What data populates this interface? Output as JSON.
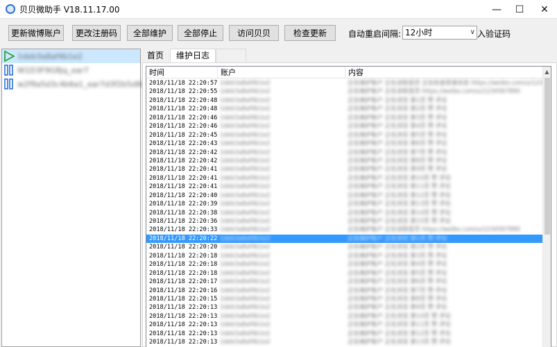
{
  "window": {
    "title": "贝贝微助手 V18.11.17.00",
    "controls": {
      "minimize": "—",
      "maximize": "☐",
      "close": "✕"
    }
  },
  "toolbar": {
    "buttons": [
      {
        "label": "更新微博账户"
      },
      {
        "label": "更改注册码"
      },
      {
        "label": "全部维护"
      },
      {
        "label": "全部停止"
      },
      {
        "label": "访问贝贝"
      },
      {
        "label": "检查更新"
      }
    ],
    "restart_label": "自动重启间隔:",
    "restart_value": "12小时",
    "captcha_label": "入验证码"
  },
  "accounts": [
    {
      "status_icon": "play-icon",
      "name": "1deb3a8af4b1e2"
    },
    {
      "status_icon": "pause-icon",
      "name": "W1D3F9G8jq_ear7"
    },
    {
      "status_icon": "pause-icon",
      "name": "w2f9a5d3c4b6a1_ear7d3f2b5d8c4b3a2e1"
    }
  ],
  "tabs": [
    {
      "label": "首页"
    },
    {
      "label": "维护日志"
    }
  ],
  "log": {
    "columns": [
      "时间",
      "账户",
      "内容"
    ],
    "rows": [
      {
        "time": "2018/11/18 22:20:57",
        "account": "1deb3a8af4b1e2",
        "content": "正在维护账户 正在读取首页 正在检查登录状态 https://weibo.com/u/1234567890"
      },
      {
        "time": "2018/11/18 22:20:55",
        "account": "1deb3a8af4b1e2",
        "content": "正在维护账户 正在读取首页 https://weibo.com/u/1234567890"
      },
      {
        "time": "2018/11/18 22:20:48",
        "account": "1deb3a8af4b1e2",
        "content": "正在维护账户 正在浏览 第1页 赞 评论"
      },
      {
        "time": "2018/11/18 22:20:48",
        "account": "1deb3a8af4b1e2",
        "content": "正在维护账户 正在浏览 第2页 赞 评论"
      },
      {
        "time": "2018/11/18 22:20:46",
        "account": "1deb3a8af4b1e2",
        "content": "正在维护账户 正在浏览 第3页 赞 评论"
      },
      {
        "time": "2018/11/18 22:20:46",
        "account": "1deb3a8af4b1e2",
        "content": "正在维护账户 正在浏览 第4页 赞 评论"
      },
      {
        "time": "2018/11/18 22:20:45",
        "account": "1deb3a8af4b1e2",
        "content": "正在维护账户 正在浏览 第5页 赞 评论"
      },
      {
        "time": "2018/11/18 22:20:43",
        "account": "1deb3a8af4b1e2",
        "content": "正在维护账户 正在浏览 第6页 赞 评论"
      },
      {
        "time": "2018/11/18 22:20:42",
        "account": "1deb3a8af4b1e2",
        "content": "正在维护账户 正在浏览 第7页 赞 评论"
      },
      {
        "time": "2018/11/18 22:20:42",
        "account": "1deb3a8af4b1e2",
        "content": "正在维护账户 正在浏览 第8页 赞 评论"
      },
      {
        "time": "2018/11/18 22:20:41",
        "account": "1deb3a8af4b1e2",
        "content": "正在维护账户 正在浏览 第9页 赞 评论"
      },
      {
        "time": "2018/11/18 22:20:41",
        "account": "1deb3a8af4b1e2",
        "content": "正在维护账户 正在浏览 第10页 赞 评论"
      },
      {
        "time": "2018/11/18 22:20:41",
        "account": "1deb3a8af4b1e2",
        "content": "正在维护账户 正在浏览 第11页 赞 评论"
      },
      {
        "time": "2018/11/18 22:20:40",
        "account": "1deb3a8af4b1e2",
        "content": "正在维护账户 正在浏览 第12页 赞 评论"
      },
      {
        "time": "2018/11/18 22:20:39",
        "account": "1deb3a8af4b1e2",
        "content": "正在维护账户 正在浏览 第13页 赞 评论"
      },
      {
        "time": "2018/11/18 22:20:38",
        "account": "1deb3a8af4b1e2",
        "content": "正在维护账户 正在浏览 第14页 赞 评论"
      },
      {
        "time": "2018/11/18 22:20:36",
        "account": "1deb3a8af4b1e2",
        "content": "正在维护账户 正在浏览 第15页 赞 评论"
      },
      {
        "time": "2018/11/18 22:20:33",
        "account": "1deb3a8af4b1e2",
        "content": "正在维护账户 正在读取首页 https://weibo.com/u/1234567890"
      },
      {
        "time": "2018/11/18 22:20:22",
        "account": "1deb3a8af4b1e2",
        "content": "正在维护账户 正在浏览 第1页 赞 评论",
        "selected": true
      },
      {
        "time": "2018/11/18 22:20:20",
        "account": "1deb3a8af4b1e2",
        "content": "正在维护账户 正在浏览 第2页 赞 评论"
      },
      {
        "time": "2018/11/18 22:20:18",
        "account": "1deb3a8af4b1e2",
        "content": "正在维护账户 正在浏览 第3页 赞 评论"
      },
      {
        "time": "2018/11/18 22:20:18",
        "account": "1deb3a8af4b1e2",
        "content": "正在维护账户 正在浏览 第4页 赞 评论"
      },
      {
        "time": "2018/11/18 22:20:18",
        "account": "1deb3a8af4b1e2",
        "content": "正在维护账户 正在浏览 第5页 赞 评论"
      },
      {
        "time": "2018/11/18 22:20:17",
        "account": "1deb3a8af4b1e2",
        "content": "正在维护账户 正在浏览 第6页 赞 评论"
      },
      {
        "time": "2018/11/18 22:20:16",
        "account": "1deb3a8af4b1e2",
        "content": "正在维护账户 正在浏览 第7页 赞 评论"
      },
      {
        "time": "2018/11/18 22:20:15",
        "account": "1deb3a8af4b1e2",
        "content": "正在维护账户 正在浏览 第8页 赞 评论"
      },
      {
        "time": "2018/11/18 22:20:13",
        "account": "1deb3a8af4b1e2",
        "content": "正在维护账户 正在浏览 第9页 赞 评论"
      },
      {
        "time": "2018/11/18 22:20:13",
        "account": "1deb3a8af4b1e2",
        "content": "正在维护账户 正在浏览 第10页 赞 评论"
      },
      {
        "time": "2018/11/18 22:20:13",
        "account": "1deb3a8af4b1e2",
        "content": "正在维护账户 正在浏览 第11页 赞 评论"
      },
      {
        "time": "2018/11/18 22:20:13",
        "account": "1deb3a8af4b1e2",
        "content": "正在维护账户 正在浏览 第12页 赞 评论"
      },
      {
        "time": "2018/11/18 22:20:13",
        "account": "1deb3a8af4b1e2",
        "content": "正在维护账户 正在浏览 第13页 赞 评论"
      }
    ]
  },
  "colors": {
    "selection": "#3399ff",
    "account_selection": "#cce8ff",
    "play_icon": "#2e9e3e",
    "pause_icon": "#2a6fd6"
  }
}
